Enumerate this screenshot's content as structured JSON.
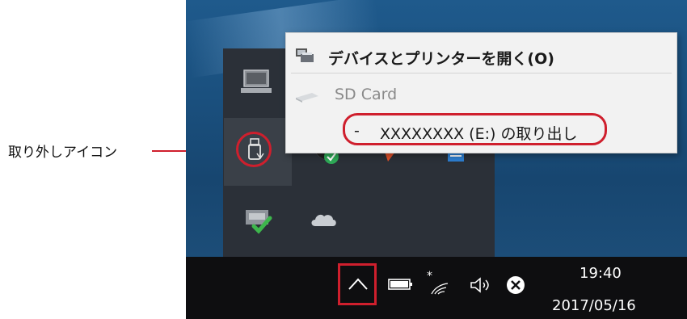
{
  "callout": {
    "label": "取り外しアイコン"
  },
  "context_menu": {
    "open_devices_label": "デバイスとプリンターを開く(O)",
    "device_name": "SD Card",
    "eject_prefix": "-",
    "eject_label": "XXXXXXXX (E:) の取り出し"
  },
  "taskbar": {
    "time": "19:40",
    "date": "2017/05/16"
  },
  "icons": {
    "tray": [
      "monitor-icon",
      "usb-eject-icon",
      "security-icon",
      "flag-icon",
      "calendar-icon",
      "printer-check-icon",
      "onedrive-cloud-icon"
    ],
    "taskbar": [
      "chevron-up-icon",
      "battery-icon",
      "wifi-icon",
      "volume-icon",
      "close-circle-icon"
    ]
  },
  "colors": {
    "annotation_red": "#cf1f2d",
    "desktop_blue": "#1a4f7d",
    "tray_bg": "#2b3038",
    "taskbar_bg": "#0e0e10",
    "menu_bg": "#f2f2f2"
  }
}
